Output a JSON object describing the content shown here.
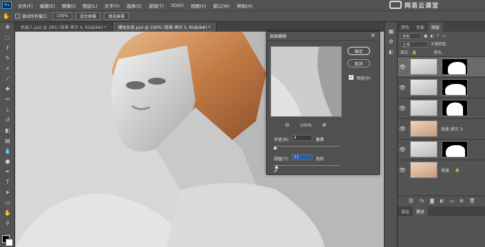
{
  "menubar": {
    "logo": "Ps",
    "items": [
      "文件(F)",
      "编辑(E)",
      "图像(I)",
      "图层(L)",
      "文字(Y)",
      "选择(S)",
      "滤镜(T)",
      "3D(D)",
      "视图(V)",
      "窗口(W)",
      "帮助(H)"
    ],
    "brand": "网易云课堂"
  },
  "options": {
    "scroll_all": "滚动所有窗口",
    "zoom": "100%",
    "fit_screen": "适合屏幕",
    "fill_screen": "填充屏幕"
  },
  "tabs": [
    {
      "label": "机器人.psd @ 28% (背景 拷贝 4, RGB/8#) *"
    },
    {
      "label": "裸体女孩.psd @ 100% (背景 拷贝 5, RGB/8#) *"
    }
  ],
  "dialog": {
    "title": "表面模糊",
    "ok": "确定",
    "cancel": "取消",
    "preview_label": "预览(P)",
    "zoom": "100%",
    "radius_label": "半径(R):",
    "radius_value": "4",
    "radius_unit": "像素",
    "threshold_label": "阈值(T):",
    "threshold_value": "11",
    "threshold_unit": "色阶",
    "radius_fraction": 0.02,
    "threshold_fraction": 0.04
  },
  "panel": {
    "tabs": [
      "颜色",
      "色板",
      "图层"
    ],
    "kind": "类型",
    "mode": "正常",
    "opacity_label": "不透明度:",
    "lock_label": "锁定:",
    "fill_label": "填充:",
    "layers": [
      {
        "name": "",
        "mask": true
      },
      {
        "name": "",
        "mask": true
      },
      {
        "name": "",
        "mask": true
      },
      {
        "name": "背景 拷贝 3",
        "mask": false
      },
      {
        "name": "",
        "mask": true
      },
      {
        "name": "背景",
        "mask": false
      }
    ],
    "bottom_tabs": [
      "通道",
      "路径"
    ]
  }
}
